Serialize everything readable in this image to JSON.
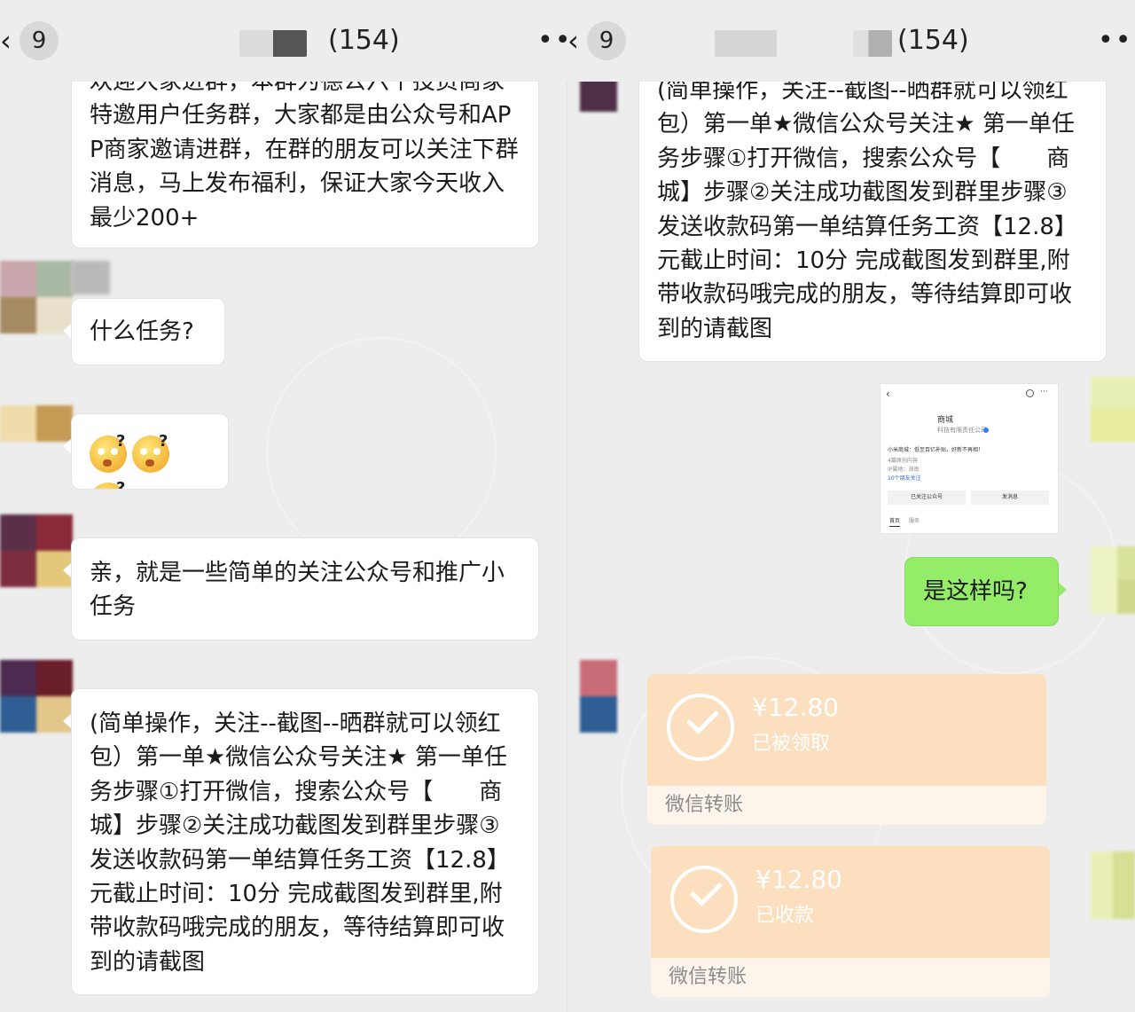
{
  "left": {
    "header": {
      "back_icon": "‹",
      "unread": "9",
      "member_count": "(154)",
      "more_icon": "•••"
    },
    "messages": [
      {
        "text": "欢迎大家进群，本群为德公六个投资商家特邀用户任务群，大家都是由公众号和APP商家邀请进群，在群的朋友可以关注下群消息，马上发布福利，保证大家今天收入最少200+"
      },
      {
        "text": "什么任务?"
      },
      {
        "emoji": [
          "dizzy-face-icon",
          "dizzy-face-icon",
          "dizzy-face-icon"
        ],
        "emoji_mark": "?"
      },
      {
        "text": "亲，就是一些简单的关注公众号和推广小任务"
      },
      {
        "text": "(简单操作，关注--截图--晒群就可以领红包）第一单★微信公众号关注★ 第一单任务步骤①打开微信，搜索公众号【　　商城】步骤②关注成功截图发到群里步骤③发送收款码第一单结算任务工资【12.8】元截止时间：10分 完成截图发到群里,附带收款码哦完成的朋友，等待结算即可收到的请截图"
      }
    ]
  },
  "right": {
    "header": {
      "back_icon": "‹",
      "unread": "9",
      "member_count": "(154)",
      "more_icon": "•••"
    },
    "messages": [
      {
        "text": "(简单操作，关注--截图--晒群就可以领红包）第一单★微信公众号关注★ 第一单任务步骤①打开微信，搜索公众号【　　商城】步骤②关注成功截图发到群里步骤③发送收款码第一单结算任务工资【12.8】元截止时间：10分 完成截图发到群里,附带收款码哦完成的朋友，等待结算即可收到的请截图"
      },
      {
        "screenshot": {
          "name": "商城",
          "company": "科技有限责任公司",
          "desc": "小米商城：低至百亿补贴，好新不再相！",
          "line2": "4篇原创内容",
          "line3": "IP属地：海南",
          "line4": "10个朋友关注",
          "btn1": "已关注公众号",
          "btn2": "发消息",
          "tab1": "首页",
          "tab2": "服务"
        }
      },
      {
        "text": "是这样吗?"
      },
      {
        "transfer": {
          "amount": "¥12.80",
          "status": "已被领取",
          "label": "微信转账"
        }
      },
      {
        "transfer": {
          "amount": "¥12.80",
          "status": "已收款",
          "label": "微信转账"
        }
      }
    ]
  },
  "colors": {
    "background": "#ededed",
    "incoming_bubble": "#ffffff",
    "outgoing_bubble": "#95ec69",
    "transfer_card": "#fbdfbf"
  }
}
